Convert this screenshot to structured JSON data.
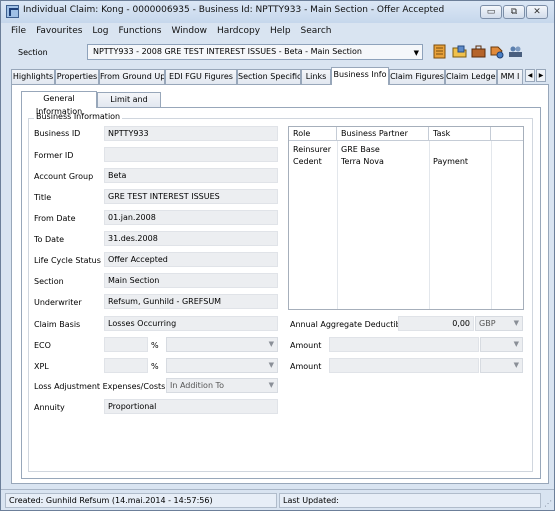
{
  "window": {
    "title": "Individual Claim: Kong - 0000006935 - Business Id: NPTTY933 - Main Section - Offer Accepted",
    "controls": {
      "minimize": "▭",
      "restore": "⧉",
      "close": "✕"
    }
  },
  "menu": [
    "File",
    "Favourites",
    "Log",
    "Functions",
    "Window",
    "Hardcopy",
    "Help",
    "Search"
  ],
  "section": {
    "label": "Section",
    "value": "NPTTY933 - 2008 GRE TEST INTEREST ISSUES - Beta - Main Section"
  },
  "toolbar_icons": [
    "notebook-icon",
    "open-folder-icon",
    "briefcase-icon",
    "tag-icon",
    "users-icon"
  ],
  "tabs": [
    "Highlights",
    "Properties",
    "From Ground Up",
    "EDI FGU Figures",
    "Section Specific",
    "Links",
    "Business Info",
    "Claim Figures",
    "Claim Ledger",
    "MM I"
  ],
  "active_tab": "Business Info",
  "subtabs": [
    "General Information",
    "Limit and Share"
  ],
  "active_subtab": "General Information",
  "group": {
    "title": "Business Information"
  },
  "fields": {
    "business_id": {
      "label": "Business ID",
      "value": "NPTTY933"
    },
    "former_id": {
      "label": "Former ID",
      "value": ""
    },
    "account_group": {
      "label": "Account Group",
      "value": "Beta"
    },
    "title": {
      "label": "Title",
      "value": "GRE TEST INTEREST ISSUES"
    },
    "from_date": {
      "label": "From Date",
      "value": "01.jan.2008"
    },
    "to_date": {
      "label": "To Date",
      "value": "31.des.2008"
    },
    "life_cycle_status": {
      "label": "Life Cycle Status",
      "value": "Offer Accepted"
    },
    "section": {
      "label": "Section",
      "value": "Main Section"
    },
    "underwriter": {
      "label": "Underwriter",
      "value": "Refsum, Gunhild - GREFSUM"
    },
    "claim_basis": {
      "label": "Claim Basis",
      "value": "Losses Occurring"
    },
    "eco": {
      "label": "ECO",
      "value": "",
      "unit": "%"
    },
    "xpl": {
      "label": "XPL",
      "value": "",
      "unit": "%"
    },
    "loss_adjustment": {
      "label": "Loss Adjustment Expenses/Costs",
      "value": "In Addition To"
    },
    "annuity": {
      "label": "Annuity",
      "value": "Proportional"
    },
    "annual_aggregate_deductible": {
      "label": "Annual Aggregate Deductible",
      "value": "0,00",
      "currency": "GBP"
    },
    "amount1": {
      "label": "Amount",
      "value": ""
    },
    "amount2": {
      "label": "Amount",
      "value": ""
    }
  },
  "partners_table": {
    "columns": [
      "Role",
      "Business Partner",
      "Task"
    ],
    "rows": [
      [
        "Reinsurer",
        "GRE Base",
        ""
      ],
      [
        "Cedent",
        "Terra Nova",
        "Payment"
      ]
    ]
  },
  "status": {
    "created": "Created: Gunhild Refsum (14.mai.2014 - 14:57:56)",
    "updated": "Last Updated:"
  }
}
